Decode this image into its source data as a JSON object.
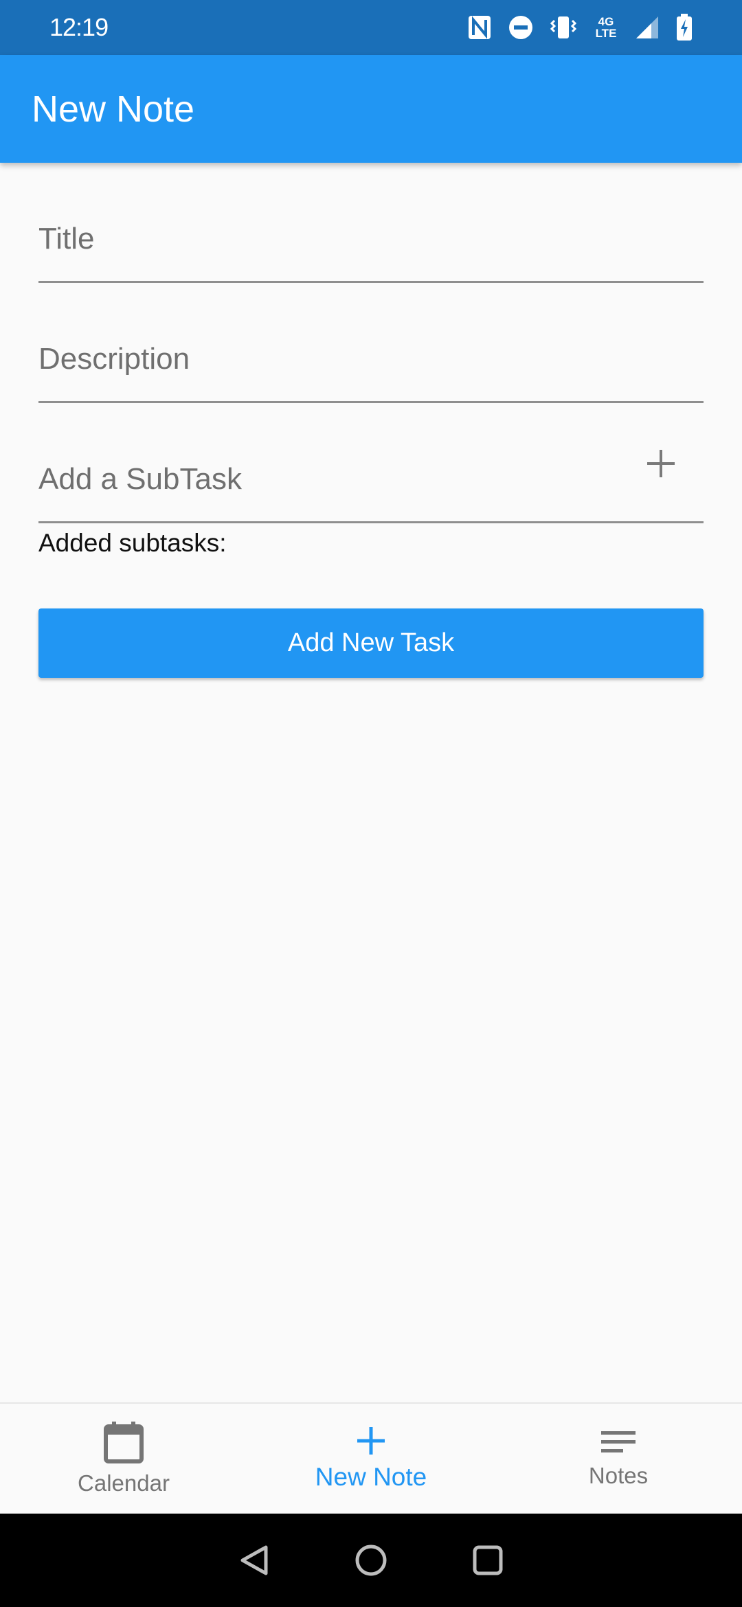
{
  "status_bar": {
    "time": "12:19",
    "network_label": "4G LTE",
    "icons": [
      "nfc-icon",
      "do-not-disturb-icon",
      "vibrate-icon",
      "network-4g-lte-icon",
      "signal-icon",
      "battery-charging-icon"
    ]
  },
  "app_bar": {
    "title": "New Note"
  },
  "form": {
    "title_placeholder": "Title",
    "description_placeholder": "Description",
    "subtask_placeholder": "Add a SubTask",
    "added_subtasks_label": "Added subtasks:",
    "submit_label": "Add New Task"
  },
  "bottom_nav": {
    "items": [
      {
        "label": "Calendar",
        "icon": "calendar-icon"
      },
      {
        "label": "New Note",
        "icon": "plus-icon"
      },
      {
        "label": "Notes",
        "icon": "notes-list-icon"
      }
    ],
    "active_index": 1
  },
  "colors": {
    "primary": "#2196f3",
    "status_bar": "#1a6fb8",
    "background": "#fafafa",
    "inactive": "#757575"
  }
}
